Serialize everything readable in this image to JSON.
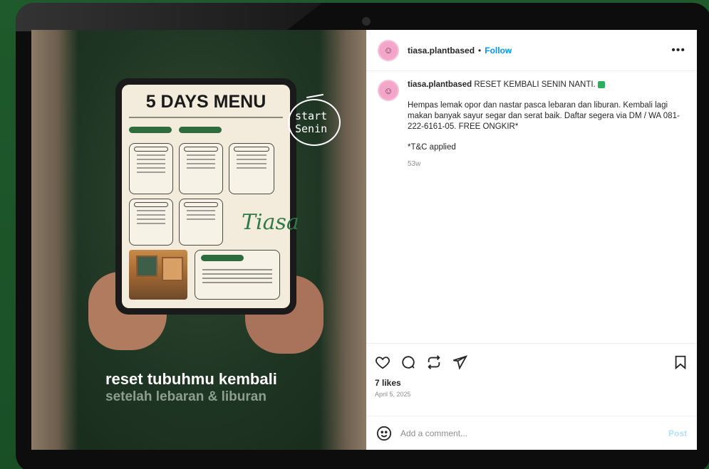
{
  "post": {
    "username": "tiasa.plantbased",
    "follow_label": "Follow",
    "separator": "•",
    "more_label": "•••",
    "caption_username": "tiasa.plantbased",
    "caption_headline": "RESET KEMBALI SENIN NANTI.",
    "caption_body": "Hempas lemak opor dan nastar pasca lebaran dan liburan. Kembali lagi makan banyak sayur segar dan serat baik. Daftar segera via DM / WA 081-222-6161-05. FREE ONGKIR*",
    "caption_note": "*T&C applied",
    "caption_time": "53w",
    "likes": "7 likes",
    "date": "April 5, 2025",
    "comment_placeholder": "Add a comment...",
    "post_label": "Post"
  },
  "image": {
    "menu_title": "5 DAYS MENU",
    "start_text_1": "start",
    "start_text_2": "Senin",
    "brand_script": "Tiasa",
    "caption_line1": "reset tubuhmu kembali",
    "caption_line2": "setelah lebaran & liburan"
  },
  "icons": {
    "like": "heart-icon",
    "comment": "comment-icon",
    "share": "repost-icon",
    "send": "send-icon",
    "save": "bookmark-icon",
    "emoji": "emoji-icon"
  },
  "colors": {
    "background": "#1f5a2c",
    "link": "#0095f6"
  }
}
